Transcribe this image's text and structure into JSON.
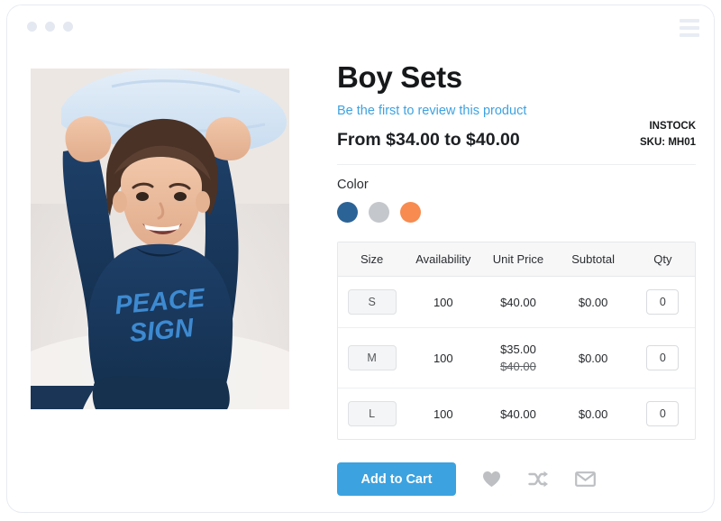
{
  "window": {
    "dots": [
      "dot-1",
      "dot-2",
      "dot-3"
    ],
    "menu_icon": "hamburger-menu-icon"
  },
  "product": {
    "title": "Boy Sets",
    "review_link": "Be the first to review this product",
    "price_range": "From $34.00 to $40.00",
    "stock_status": "INSTOCK",
    "sku": "SKU: MH01",
    "image_alt": "Young boy in navy PEACE SIGN sweatshirt holding a light blue pillow overhead"
  },
  "options": {
    "color_label": "Color",
    "swatches": [
      {
        "name": "swatch-navy",
        "color": "#2b6396",
        "selected": true
      },
      {
        "name": "swatch-gray",
        "color": "#c4c7cb",
        "selected": false
      },
      {
        "name": "swatch-orange",
        "color": "#f78b50",
        "selected": false
      }
    ]
  },
  "table": {
    "headers": [
      "Size",
      "Availability",
      "Unit Price",
      "Subtotal",
      "Qty"
    ],
    "rows": [
      {
        "size": "S",
        "availability": "100",
        "unit_price": "$40.00",
        "old_price": "",
        "subtotal": "$0.00",
        "qty": "0"
      },
      {
        "size": "M",
        "availability": "100",
        "unit_price": "$35.00",
        "old_price": "$40.00",
        "subtotal": "$0.00",
        "qty": "0"
      },
      {
        "size": "L",
        "availability": "100",
        "unit_price": "$40.00",
        "old_price": "",
        "subtotal": "$0.00",
        "qty": "0"
      }
    ]
  },
  "actions": {
    "add_to_cart": "Add to Cart",
    "icons": [
      {
        "name": "heart-icon",
        "title": "Add to Wish List"
      },
      {
        "name": "shuffle-compare-icon",
        "title": "Add to Compare"
      },
      {
        "name": "envelope-icon",
        "title": "Email to a Friend"
      }
    ]
  },
  "colors": {
    "accent_blue": "#3ca2e0",
    "link_blue": "#3ea2e0",
    "icon_gray": "#bdbfc2",
    "header_bg": "#f7f7f8"
  }
}
